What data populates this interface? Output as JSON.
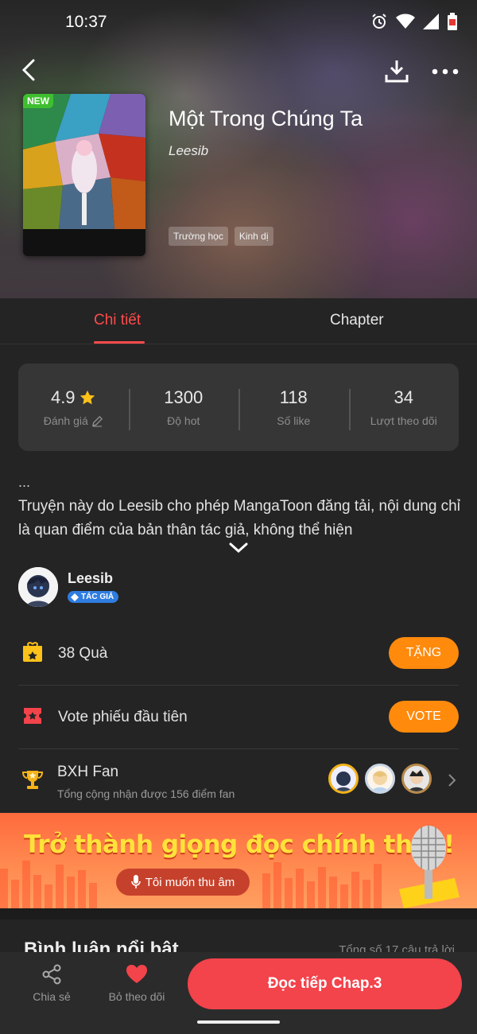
{
  "status_bar": {
    "time": "10:37",
    "icons": [
      "alarm-icon",
      "wifi-icon",
      "signal-icon",
      "battery-icon"
    ]
  },
  "header": {
    "cover_badge": "NEW",
    "title": "Một Trong Chúng Ta",
    "author": "Leesib",
    "tags": [
      "Trường học",
      "Kinh dị"
    ]
  },
  "tabs": [
    {
      "label": "Chi tiết",
      "active": true
    },
    {
      "label": "Chapter",
      "active": false
    }
  ],
  "stats": [
    {
      "value": "4.9",
      "label": "Đánh giá"
    },
    {
      "value": "1300",
      "label": "Độ hot"
    },
    {
      "value": "118",
      "label": "Số like"
    },
    {
      "value": "34",
      "label": "Lượt theo dõi"
    }
  ],
  "description": {
    "ellipsis": "...",
    "text": "Truyện này do Leesib cho phép MangaToon đăng tải, nội dung chỉ là quan điểm của bản thân tác giả, không thể hiện"
  },
  "author_block": {
    "name": "Leesib",
    "badge": "TÁC GIẢ"
  },
  "gift": {
    "label": "38 Quà",
    "button": "TẶNG"
  },
  "vote": {
    "label": "Vote phiếu đầu tiên",
    "button": "VOTE"
  },
  "fan_rank": {
    "title": "BXH Fan",
    "subtitle": "Tổng cộng nhận được 156 điểm fan"
  },
  "banner": {
    "title": "Trở thành giọng đọc chính thức!",
    "button": "Tôi muốn thu âm"
  },
  "comments": {
    "title": "Bình luận nổi bật",
    "total": "Tổng số 17 câu trả lời"
  },
  "bottom_bar": {
    "share_label": "Chia sẻ",
    "follow_label": "Bỏ theo dõi",
    "read_label": "Đọc tiếp Chap.3"
  },
  "colors": {
    "accent_red": "#ff4b4b",
    "button_orange": "#ff8a0c",
    "read_button": "#f3434b",
    "background": "#242424",
    "card": "#363636"
  }
}
